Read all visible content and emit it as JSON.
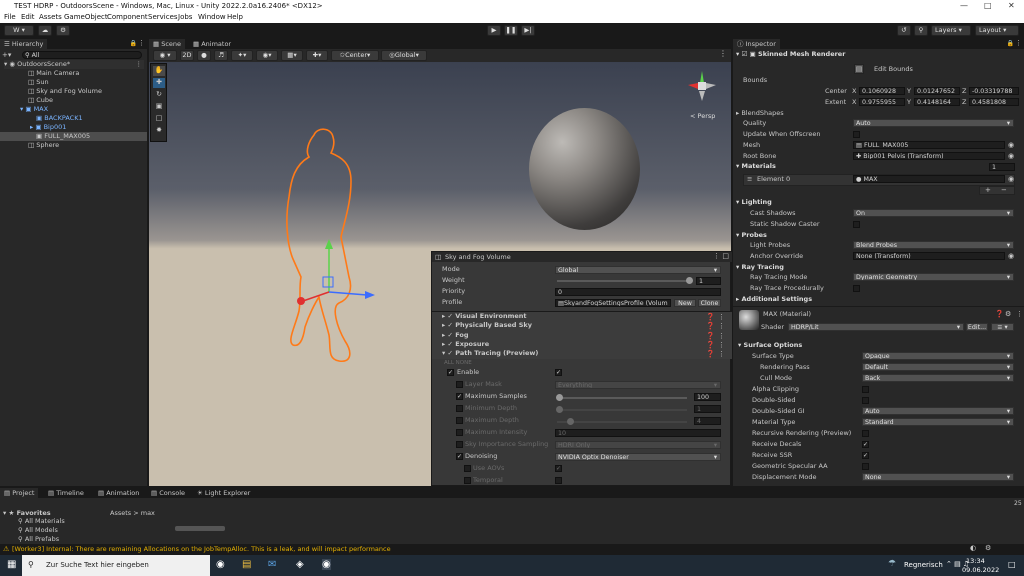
{
  "window": {
    "title": "TEST HDRP - OutdoorsScene - Windows, Mac, Linux - Unity 2022.2.0a16.2406* <DX12>"
  },
  "menu": [
    "File",
    "Edit",
    "Assets",
    "GameObject",
    "Component",
    "Services",
    "Jobs",
    "Window",
    "Help"
  ],
  "toolbar": {
    "account": "W",
    "layers": "Layers",
    "layout": "Layout"
  },
  "hierarchy": {
    "tab": "Hierarchy",
    "search": "All",
    "items": [
      {
        "label": "OutdoorsScene*"
      },
      {
        "label": "Main Camera"
      },
      {
        "label": "Sun"
      },
      {
        "label": "Sky and Fog Volume"
      },
      {
        "label": "Cube"
      },
      {
        "label": "MAX"
      },
      {
        "label": "BACKPACK1"
      },
      {
        "label": "Bip001"
      },
      {
        "label": "FULL_MAX005"
      },
      {
        "label": "Sphere"
      }
    ]
  },
  "scene": {
    "tabs": [
      "Scene",
      "Animator"
    ],
    "mode_2d": "2D",
    "pivot": "Center",
    "space": "Global",
    "persp": "< Persp"
  },
  "volume": {
    "title": "Sky and Fog Volume",
    "mode_label": "Mode",
    "mode": "Global",
    "weight_label": "Weight",
    "weight": "1",
    "priority_label": "Priority",
    "priority": "0",
    "profile_label": "Profile",
    "profile": "SkyandFogSettingsProfile (Volum",
    "new": "New",
    "clone": "Clone",
    "overrides": [
      {
        "label": "Visual Environment"
      },
      {
        "label": "Physically Based Sky"
      },
      {
        "label": "Fog"
      },
      {
        "label": "Exposure"
      },
      {
        "label": "Path Tracing (Preview)"
      }
    ],
    "all_none": "ALL  NONE",
    "enable": "Enable",
    "layer_mask": "Layer Mask",
    "layer_mask_val": "Everything",
    "max_samples": "Maximum Samples",
    "max_samples_val": "100",
    "min_depth": "Minimum Depth",
    "min_depth_val": "1",
    "max_depth": "Maximum Depth",
    "max_depth_val": "4",
    "max_intensity": "Maximum Intensity",
    "max_intensity_val": "10",
    "sky_sampling": "Sky Importance Sampling",
    "sky_sampling_val": "HDRI Only",
    "denoising": "Denoising",
    "denoising_val": "NVIDIA Optix Denoiser",
    "use_aovs": "Use AOVs",
    "temporal": "Temporal"
  },
  "inspector": {
    "tab": "Inspector",
    "component": "Skinned Mesh Renderer",
    "edit_bounds": "Edit Bounds",
    "bounds": "Bounds",
    "center": "Center",
    "extent": "Extent",
    "cx": "0.1060928",
    "cy": "0.01247652",
    "cz": "-0.03319788",
    "ex": "0.9755955",
    "ey": "0.4148164",
    "ez": "0.4581808",
    "x": "X",
    "y": "Y",
    "z": "Z",
    "blendshapes": "BlendShapes",
    "quality": "Quality",
    "quality_val": "Auto",
    "update_offscreen": "Update When Offscreen",
    "mesh": "Mesh",
    "mesh_val": "FULL_MAX005",
    "root_bone": "Root Bone",
    "root_bone_val": "Bip001 Pelvis (Transform)",
    "materials": "Materials",
    "materials_count": "1",
    "element0": "Element 0",
    "element0_val": "MAX",
    "lighting": "Lighting",
    "cast_shadows": "Cast Shadows",
    "cast_shadows_val": "On",
    "static_caster": "Static Shadow Caster",
    "probes": "Probes",
    "light_probes": "Light Probes",
    "light_probes_val": "Blend Probes",
    "anchor": "Anchor Override",
    "anchor_val": "None (Transform)",
    "ray_tracing": "Ray Tracing",
    "rt_mode": "Ray Tracing Mode",
    "rt_mode_val": "Dynamic Geometry",
    "rt_proc": "Ray Trace Procedurally",
    "additional": "Additional Settings",
    "material_name": "MAX (Material)",
    "shader": "Shader",
    "shader_val": "HDRP/Lit",
    "edit": "Edit...",
    "surface_options": "Surface Options",
    "surface_type": "Surface Type",
    "surface_type_val": "Opaque",
    "rendering_pass": "Rendering Pass",
    "rendering_pass_val": "Default",
    "cull_mode": "Cull Mode",
    "cull_mode_val": "Back",
    "alpha_clipping": "Alpha Clipping",
    "double_sided": "Double-Sided",
    "double_sided_gi": "Double-Sided GI",
    "double_sided_gi_val": "Auto",
    "material_type": "Material Type",
    "material_type_val": "Standard",
    "recursive": "Recursive Rendering (Preview)",
    "receive_decals": "Receive Decals",
    "receive_ssr": "Receive SSR",
    "geo_aa": "Geometric Specular AA",
    "displacement": "Displacement Mode",
    "displacement_val": "None"
  },
  "project": {
    "tabs": [
      "Project",
      "Timeline",
      "Animation",
      "Console",
      "Light Explorer"
    ],
    "favorites": "Favorites",
    "fav_items": [
      "All Materials",
      "All Models",
      "All Prefabs"
    ],
    "breadcrumb": "Assets > max",
    "count": "25"
  },
  "status": {
    "message": "[Worker3] Internal: There are remaining Allocations on the JobTempAlloc. This is a leak, and will impact performance"
  },
  "taskbar": {
    "search": "Zur Suche Text hier eingeben",
    "weather": "Regnerisch",
    "time": "13:34",
    "date": "09.06.2022"
  }
}
